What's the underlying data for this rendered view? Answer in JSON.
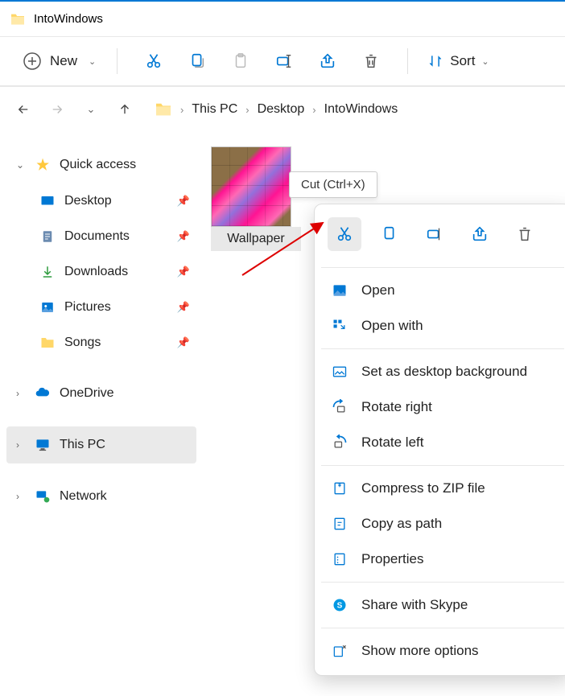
{
  "titlebar": {
    "title": "IntoWindows"
  },
  "toolbar": {
    "new_label": "New",
    "sort_label": "Sort"
  },
  "breadcrumb": {
    "items": [
      "This PC",
      "Desktop",
      "IntoWindows"
    ]
  },
  "sidebar": {
    "quick_access": "Quick access",
    "items": [
      {
        "label": "Desktop"
      },
      {
        "label": "Documents"
      },
      {
        "label": "Downloads"
      },
      {
        "label": "Pictures"
      },
      {
        "label": "Songs"
      }
    ],
    "onedrive": "OneDrive",
    "thispc": "This PC",
    "network": "Network"
  },
  "content": {
    "file_name": "Wallpaper"
  },
  "tooltip": "Cut (Ctrl+X)",
  "context_menu": {
    "items": [
      {
        "label": "Open"
      },
      {
        "label": "Open with"
      },
      {
        "label": "Set as desktop background"
      },
      {
        "label": "Rotate right"
      },
      {
        "label": "Rotate left"
      },
      {
        "label": "Compress to ZIP file"
      },
      {
        "label": "Copy as path"
      },
      {
        "label": "Properties"
      },
      {
        "label": "Share with Skype"
      },
      {
        "label": "Show more options"
      }
    ]
  }
}
